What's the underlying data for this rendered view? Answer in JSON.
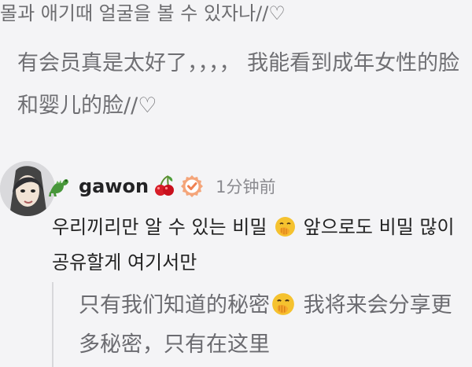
{
  "post": {
    "partial_line": "몰과 애기때 얼굴을 볼 수 있자나//♡",
    "translation": "有会员真是太好了，，，， 我能看到成年女性的脸和婴儿的脸//♡"
  },
  "comment": {
    "username": "gawon",
    "time": "1分钟前",
    "text_before_emoji": "우리끼리만 알 수 있는 비밀 ",
    "text_after_emoji": "  앞으로도 비밀 많이 공유할게 여기서만",
    "translation_before_emoji": "只有我们知道的秘密",
    "translation_after_emoji": " 我将来会分享更多秘密，只有在这里"
  },
  "icons": {
    "avatar": "avatar-image",
    "dinosaur": "dinosaur-icon",
    "cherries": "cherries-icon",
    "verified": "verified-badge-icon",
    "emoji": "face-with-hand-over-mouth-emoji"
  },
  "colors": {
    "background": "#f4f4f6",
    "primary_text": "#222222",
    "secondary_text": "#6f6f73",
    "muted_time": "#8a8a8f",
    "verified_orange": "#f4a57a"
  }
}
